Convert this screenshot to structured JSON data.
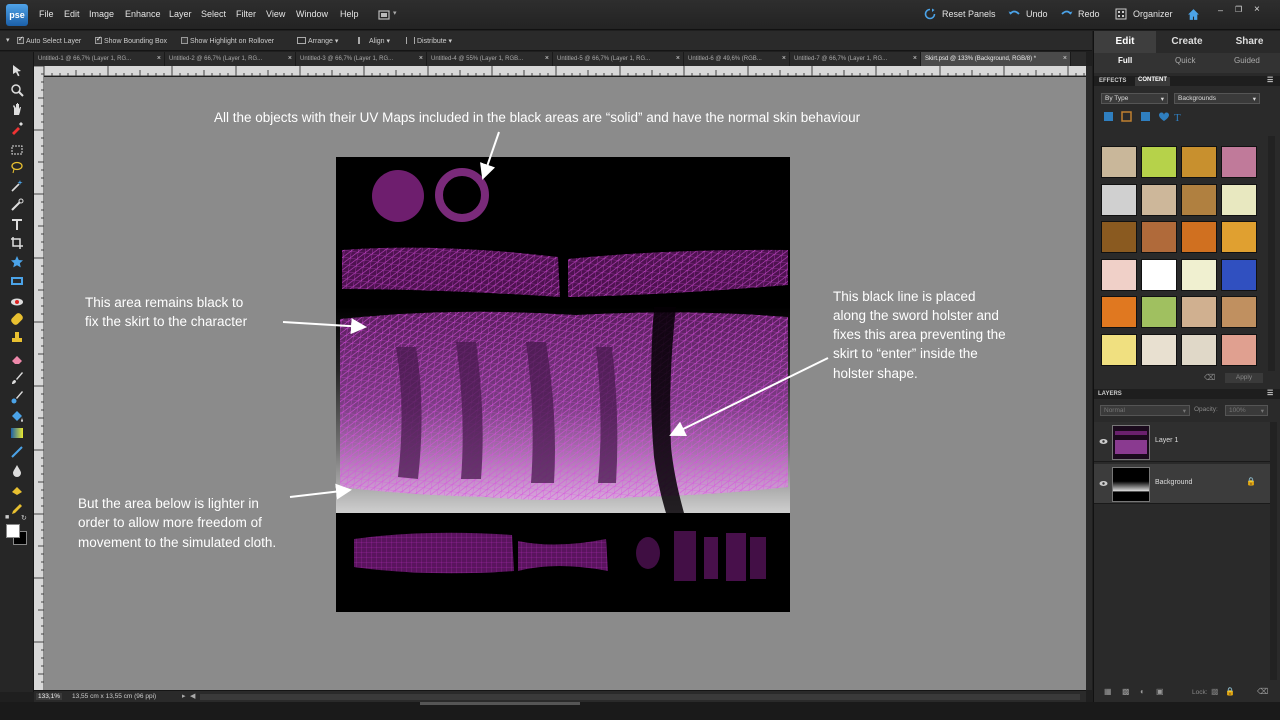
{
  "app": {
    "logo": "pse"
  },
  "menubar": {
    "items": [
      "File",
      "Edit",
      "Image",
      "Enhance",
      "Layer",
      "Select",
      "Filter",
      "View",
      "Window",
      "Help"
    ],
    "reset_panels": "Reset Panels",
    "undo": "Undo",
    "redo": "Redo",
    "organizer": "Organizer"
  },
  "options_bar": {
    "auto_select_layer": "Auto Select Layer",
    "show_bounding_box": "Show Bounding Box",
    "show_highlight": "Show Highlight on Rollover",
    "arrange": "Arrange",
    "align": "Align",
    "distribute": "Distribute"
  },
  "tabs": [
    "Untitled-1 @ 66,7% (Layer 1, RG...",
    "Untitled-2 @ 66,7% (Layer 1, RG...",
    "Untitled-3 @ 66,7% (Layer 1, RG...",
    "Untitled-4 @ 55% (Layer 1, RGB...",
    "Untitled-5 @ 66,7% (Layer 1, RG...",
    "Untitled-6 @ 49,6% (RGB...",
    "Untitled-7 @ 66,7% (Layer 1, RG...",
    "Skirt.psd @ 133% (Background, RGB/8) *"
  ],
  "annotations": {
    "top": "All the objects with their UV Maps included in the black areas are “solid”  and have the normal skin behaviour",
    "left_line1": "This area remains black to",
    "left_line2": "fix the skirt to the character",
    "right_line1": "This black line is placed",
    "right_line2": "along the sword holster and",
    "right_line3": "fixes this area preventing the",
    "right_line4": "skirt to “enter” inside the",
    "right_line5": "holster shape.",
    "bottom_line1": "But the area below is lighter in",
    "bottom_line2": "order to allow more freedom of",
    "bottom_line3": "movement to the simulated cloth."
  },
  "status": {
    "zoom": "133,1%",
    "doc_size": "13,55 cm x 13,55 cm (96 ppi)"
  },
  "panel": {
    "tabs": [
      "Edit",
      "Create",
      "Share"
    ],
    "subtabs": [
      "Full",
      "Quick",
      "Guided"
    ],
    "effects": "EFFECTS",
    "content": "CONTENT",
    "by_type": "By Type",
    "backgrounds": "Backgrounds",
    "apply": "Apply",
    "layers_head": "LAYERS",
    "blend_mode": "Normal",
    "opacity_label": "Opacity:",
    "opacity_value": "100%",
    "lock_label": "Lock:",
    "layers": [
      {
        "name": "Layer 1"
      },
      {
        "name": "Background"
      }
    ]
  },
  "colors": {
    "thumbs": [
      "#c9b79a",
      "#b6d24a",
      "#c8902e",
      "#c07a9a",
      "#d0d0d0",
      "#cdb79a",
      "#b08040",
      "#e8e8c0",
      "#8a5a20",
      "#b06a3a",
      "#d07020",
      "#e0a030",
      "#f0d0c8",
      "#ffffff",
      "#f0f0d0",
      "#3050c0",
      "#e07820",
      "#a0c060",
      "#d0b090",
      "#c09060",
      "#f0e080",
      "#e8e0d0",
      "#e0d8c8",
      "#e0a090"
    ]
  }
}
